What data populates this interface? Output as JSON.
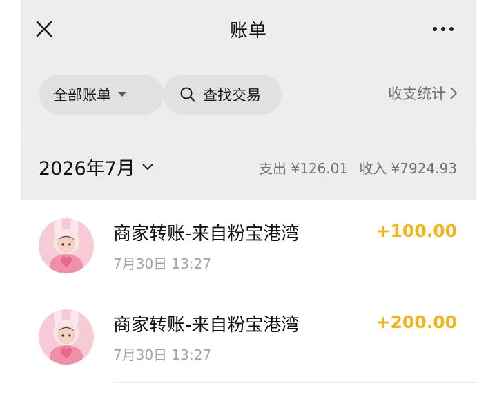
{
  "header": {
    "title": "账单",
    "close_icon": "close-icon",
    "more_icon": "more-icon"
  },
  "filters": {
    "all_bills_label": "全部账单",
    "search_label": "查找交易",
    "stats_label": "收支统计"
  },
  "month": {
    "label": "2026年7月",
    "expense": "支出 ¥126.01",
    "income": "收入 ¥7924.93"
  },
  "transactions": [
    {
      "title": "商家转账-来自粉宝港湾",
      "time": "7月30日 13:27",
      "amount": "+100.00"
    },
    {
      "title": "商家转账-来自粉宝港湾",
      "time": "7月30日 13:27",
      "amount": "+200.00"
    }
  ],
  "colors": {
    "background_top": "#ededed",
    "income_accent": "#f2b41c",
    "avatar_pink": "#f6cbd6"
  }
}
